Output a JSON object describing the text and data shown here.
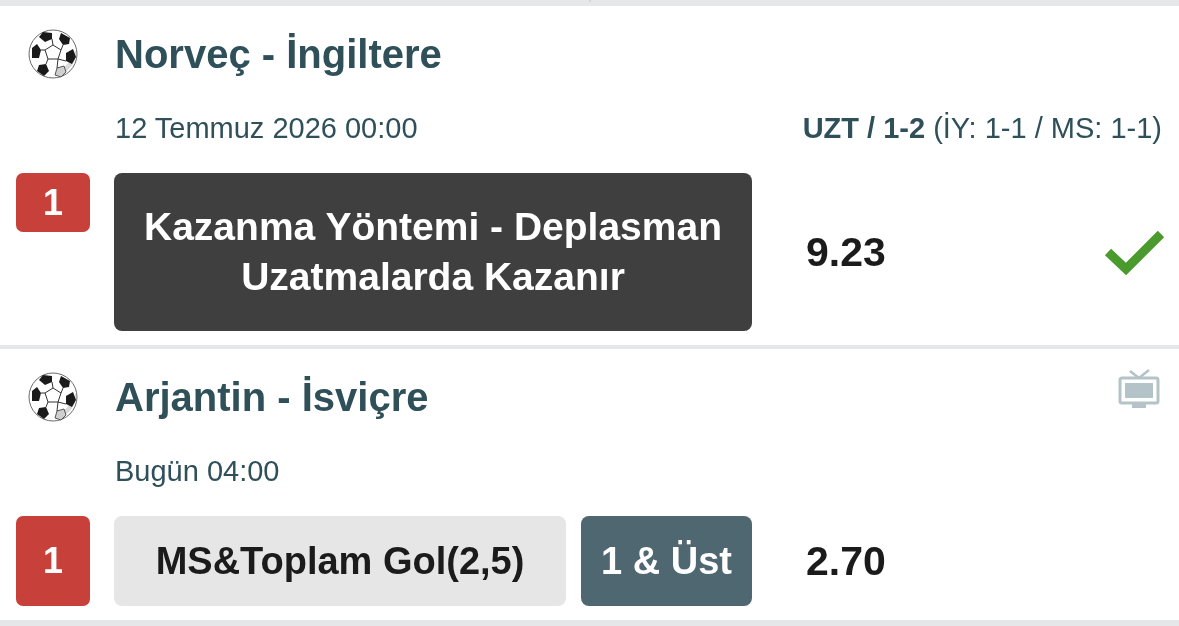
{
  "matches": [
    {
      "title": "Norveç - İngiltere",
      "date": "12 Temmuz 2026 00:00",
      "result": "**UZT / 1-2** (İY: 1-1 / MS: 1-1)",
      "selection": {
        "number": "1",
        "market": "Kazanma Yöntemi - Deplasman Uzatmalarda Kazanır",
        "odds": "9.23",
        "won": true
      }
    },
    {
      "title": "Arjantin - İsviçre",
      "date": "Bugün 04:00",
      "live_stream": true,
      "selection": {
        "number": "1",
        "market": "MS&Toplam Gol(2,5)",
        "pick": "1 & Üst",
        "odds": "2.70"
      }
    }
  ]
}
